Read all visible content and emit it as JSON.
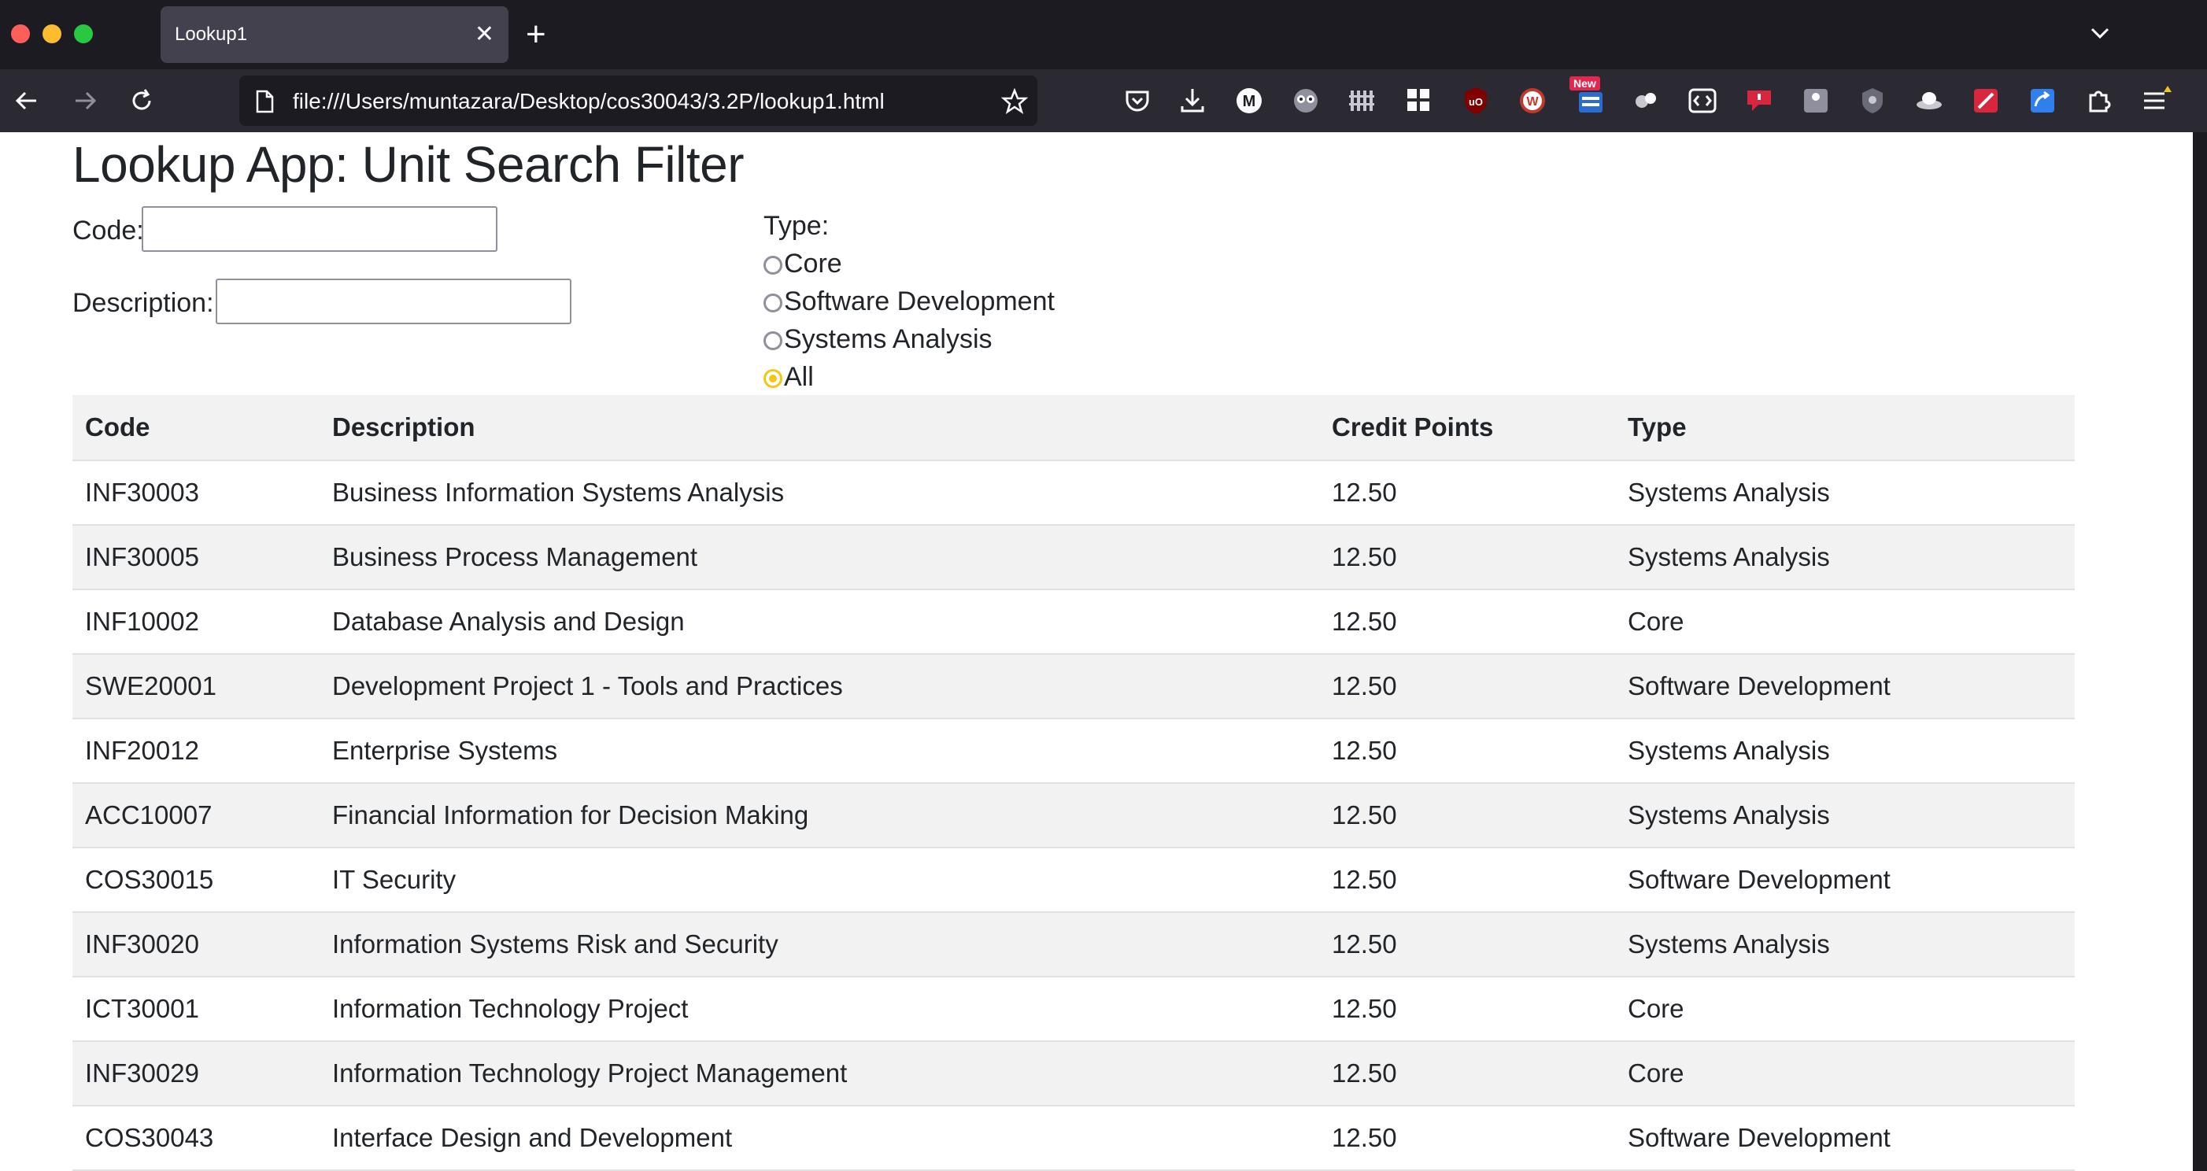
{
  "browser": {
    "tab_title": "Lookup1",
    "close_tab_glyph": "✕",
    "new_tab_glyph": "+",
    "url": "file:///Users/muntazara/Desktop/cos30043/3.2P/lookup1.html",
    "extension_badge": "New"
  },
  "page": {
    "title": "Lookup App: Unit Search Filter",
    "code_label": "Code:",
    "code_value": "",
    "description_label": "Description:",
    "description_value": "",
    "type_label": "Type:",
    "type_options": [
      {
        "label": "Core",
        "checked": false
      },
      {
        "label": "Software Development",
        "checked": false
      },
      {
        "label": "Systems Analysis",
        "checked": false
      },
      {
        "label": "All",
        "checked": true
      }
    ]
  },
  "table": {
    "headers": [
      "Code",
      "Description",
      "Credit Points",
      "Type"
    ],
    "rows": [
      [
        "INF30003",
        "Business Information Systems Analysis",
        "12.50",
        "Systems Analysis"
      ],
      [
        "INF30005",
        "Business Process Management",
        "12.50",
        "Systems Analysis"
      ],
      [
        "INF10002",
        "Database Analysis and Design",
        "12.50",
        "Core"
      ],
      [
        "SWE20001",
        "Development Project 1 - Tools and Practices",
        "12.50",
        "Software Development"
      ],
      [
        "INF20012",
        "Enterprise Systems",
        "12.50",
        "Systems Analysis"
      ],
      [
        "ACC10007",
        "Financial Information for Decision Making",
        "12.50",
        "Systems Analysis"
      ],
      [
        "COS30015",
        "IT Security",
        "12.50",
        "Software Development"
      ],
      [
        "INF30020",
        "Information Systems Risk and Security",
        "12.50",
        "Systems Analysis"
      ],
      [
        "ICT30001",
        "Information Technology Project",
        "12.50",
        "Core"
      ],
      [
        "INF30029",
        "Information Technology Project Management",
        "12.50",
        "Core"
      ],
      [
        "COS30043",
        "Interface Design and Development",
        "12.50",
        "Software Development"
      ]
    ]
  }
}
